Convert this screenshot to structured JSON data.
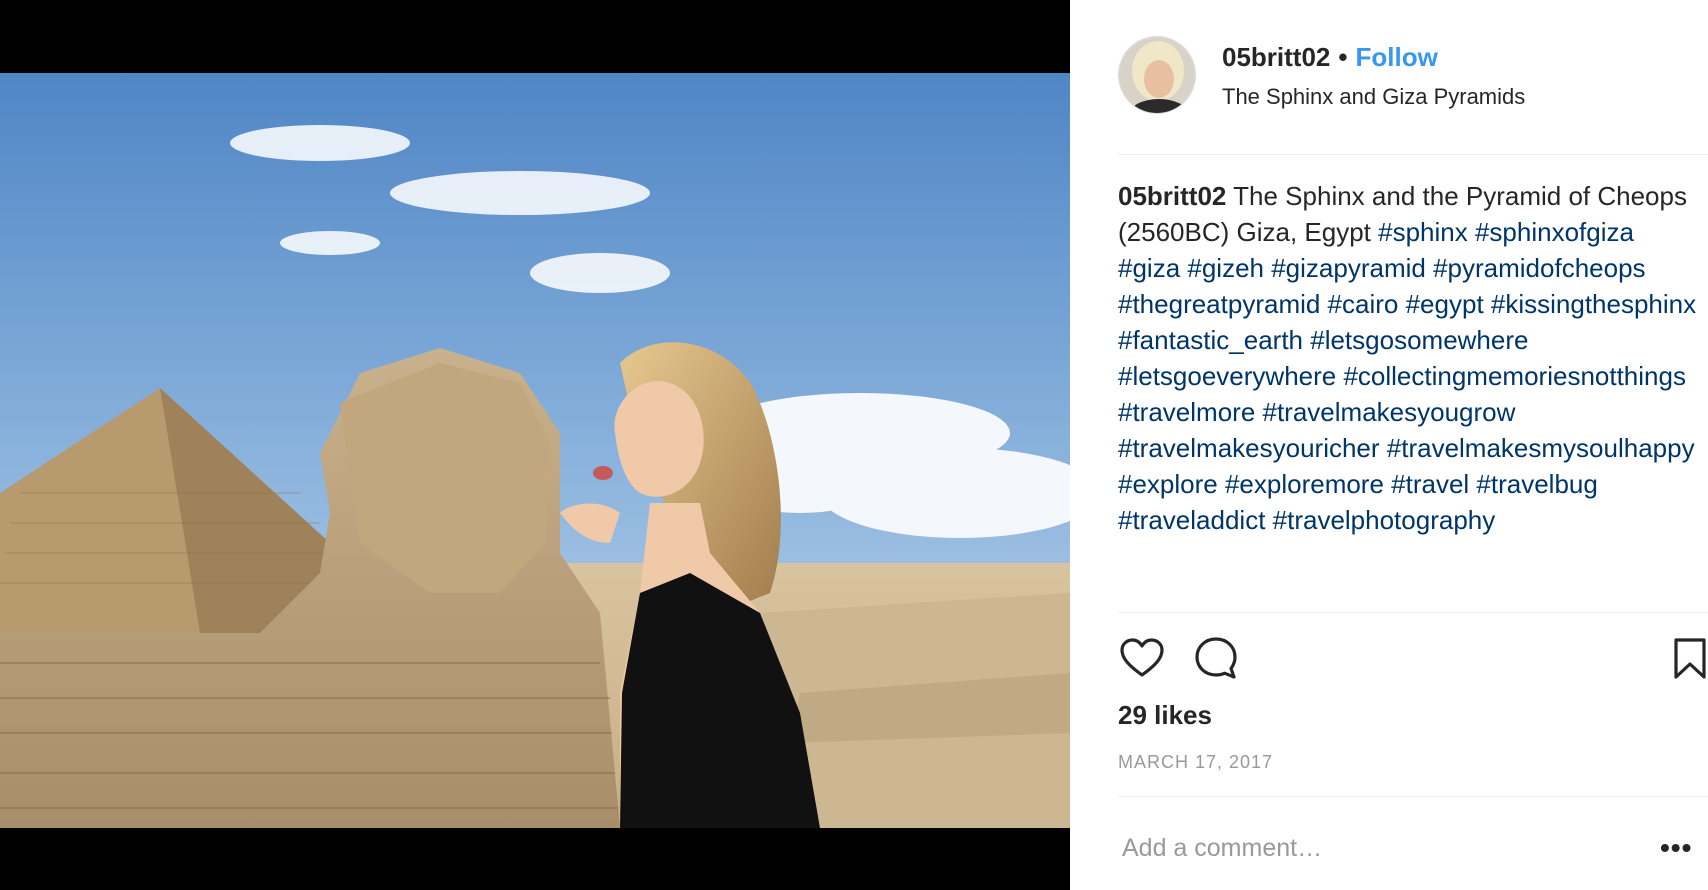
{
  "post": {
    "username": "05britt02",
    "separator": "•",
    "follow_label": "Follow",
    "location": "The Sphinx and Giza Pyramids",
    "caption_user": "05britt02",
    "caption_text": "The Sphinx and the Pyramid of Cheops (2560BC) Giza, Egypt",
    "hashtags": "#sphinx #sphinxofgiza #giza #gizeh #gizapyramid #pyramidofcheops #thegreatpyramid #cairo #egypt #kissingthesphinx #fantastic_earth #letsgosomewhere #letsgoeverywhere #collectingmemoriesnotthings #travelmore #travelmakesyougrow #travelmakesyouricher #travelmakesmysoulhappy #explore #exploremore #travel #travelbug #traveladdict #travelphotography",
    "likes": "29 likes",
    "date": "MARCH 17, 2017",
    "comment_placeholder": "Add a comment…",
    "more_label": "•••"
  },
  "icons": {
    "like": "heart-icon",
    "comment": "comment-icon",
    "save": "bookmark-icon"
  },
  "colors": {
    "follow": "#3897f0",
    "hashtag": "#003569",
    "muted": "#999999"
  }
}
